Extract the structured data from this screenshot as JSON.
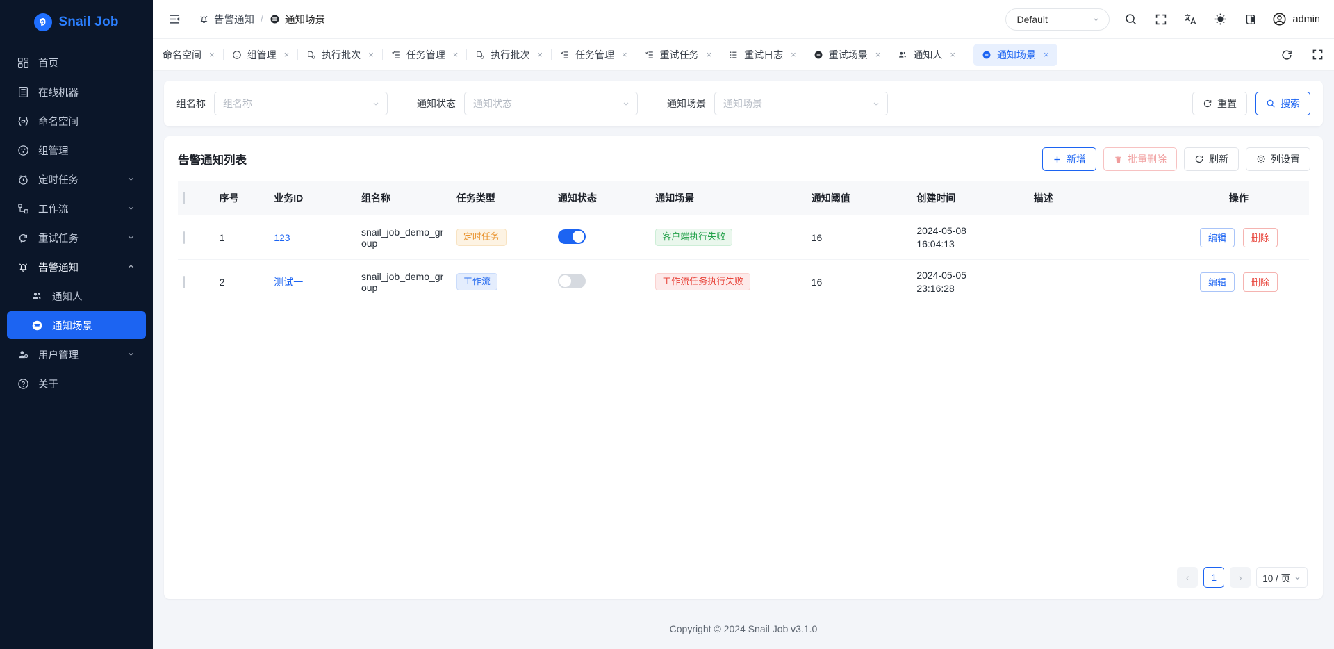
{
  "brand": {
    "name": "Snail Job",
    "logo_icon": "snail-logo-icon"
  },
  "sidebar": {
    "items": [
      {
        "label": "首页",
        "icon": "dashboard-icon",
        "expandable": false,
        "active": false
      },
      {
        "label": "在线机器",
        "icon": "server-icon",
        "expandable": false,
        "active": false
      },
      {
        "label": "命名空间",
        "icon": "namespace-icon",
        "expandable": false,
        "active": false
      },
      {
        "label": "组管理",
        "icon": "group-icon",
        "expandable": false,
        "active": false
      },
      {
        "label": "定时任务",
        "icon": "clock-task-icon",
        "expandable": true,
        "active": false
      },
      {
        "label": "工作流",
        "icon": "workflow-icon",
        "expandable": true,
        "active": false
      },
      {
        "label": "重试任务",
        "icon": "retry-icon",
        "expandable": true,
        "active": false
      },
      {
        "label": "告警通知",
        "icon": "bell-icon",
        "expandable": true,
        "active": false,
        "expanded": true
      },
      {
        "label": "通知人",
        "icon": "users-icon",
        "sub": true,
        "active": false
      },
      {
        "label": "通知场景",
        "icon": "scene-icon",
        "sub": true,
        "active": true
      },
      {
        "label": "用户管理",
        "icon": "user-manage-icon",
        "expandable": true,
        "active": false
      },
      {
        "label": "关于",
        "icon": "about-icon",
        "expandable": false,
        "active": false
      }
    ]
  },
  "header": {
    "collapse_icon": "collapse-sidebar-icon",
    "breadcrumb": {
      "parent": "告警通知",
      "parent_icon": "bell-icon",
      "separator": "/",
      "current": "通知场景",
      "current_icon": "scene-icon"
    },
    "theme_select": {
      "value": "Default",
      "chevron": "chevron-down-icon"
    },
    "icons": [
      "search-icon",
      "fullscreen-icon",
      "translate-icon",
      "theme-sun-icon",
      "layout-icon"
    ],
    "user": {
      "name": "admin",
      "avatar_icon": "user-circle-icon"
    }
  },
  "tabbar": {
    "tabs": [
      {
        "label": "命名空间",
        "icon": "namespace-icon",
        "active": false,
        "truncated": true
      },
      {
        "label": "组管理",
        "icon": "group-icon",
        "active": false
      },
      {
        "label": "执行批次",
        "icon": "batch-icon",
        "active": false
      },
      {
        "label": "任务管理",
        "icon": "task-icon",
        "active": false
      },
      {
        "label": "执行批次",
        "icon": "batch-icon",
        "active": false
      },
      {
        "label": "任务管理",
        "icon": "task-icon",
        "active": false
      },
      {
        "label": "重试任务",
        "icon": "task-icon",
        "active": false
      },
      {
        "label": "重试日志",
        "icon": "log-icon",
        "active": false
      },
      {
        "label": "重试场景",
        "icon": "scene-icon",
        "active": false
      },
      {
        "label": "通知人",
        "icon": "users-icon",
        "active": false
      },
      {
        "label": "通知场景",
        "icon": "scene-icon",
        "active": true
      }
    ],
    "close_label": "×",
    "actions": [
      "reload-icon",
      "fullscreen-icon"
    ]
  },
  "filters": {
    "fields": [
      {
        "label": "组名称",
        "placeholder": "组名称",
        "value": "",
        "name": "group-name"
      },
      {
        "label": "通知状态",
        "placeholder": "通知状态",
        "value": "",
        "name": "notify-status"
      },
      {
        "label": "通知场景",
        "placeholder": "通知场景",
        "value": "",
        "name": "notify-scene"
      }
    ],
    "reset_label": "重置",
    "reset_icon": "refresh-icon",
    "search_label": "搜索",
    "search_icon": "search-icon"
  },
  "list": {
    "title": "告警通知列表",
    "buttons": [
      {
        "label": "新增",
        "icon": "plus-icon",
        "style": "primary-outline"
      },
      {
        "label": "批量删除",
        "icon": "trash-icon",
        "style": "danger-outline-disabled"
      },
      {
        "label": "刷新",
        "icon": "refresh-icon",
        "style": "default"
      },
      {
        "label": "列设置",
        "icon": "gear-icon",
        "style": "default"
      }
    ],
    "columns": [
      "序号",
      "业务ID",
      "组名称",
      "任务类型",
      "通知状态",
      "通知场景",
      "通知阈值",
      "创建时间",
      "描述",
      "操作"
    ],
    "rows": [
      {
        "index": "1",
        "business_id": "123",
        "group_name": "snail_job_demo_group",
        "task_type": "定时任务",
        "task_type_color": "orange",
        "notify_status": true,
        "scene": "客户端执行失败",
        "scene_color": "green",
        "threshold": "16",
        "created_date": "2024-05-08",
        "created_time": "16:04:13",
        "description": "",
        "edit_label": "编辑",
        "delete_label": "删除"
      },
      {
        "index": "2",
        "business_id": "测试一",
        "group_name": "snail_job_demo_group",
        "task_type": "工作流",
        "task_type_color": "blue",
        "notify_status": false,
        "scene": "工作流任务执行失败",
        "scene_color": "red",
        "threshold": "16",
        "created_date": "2024-05-05",
        "created_time": "23:16:28",
        "description": "",
        "edit_label": "编辑",
        "delete_label": "删除"
      }
    ]
  },
  "pagination": {
    "prev": "‹",
    "page": "1",
    "next": "›",
    "page_size": "10 / 页"
  },
  "footer": {
    "text": "Copyright © 2024 Snail Job v3.1.0"
  },
  "colors": {
    "accent": "#1c64f2",
    "sidebar_bg": "#0b1629",
    "page_bg": "#f3f5f9"
  }
}
